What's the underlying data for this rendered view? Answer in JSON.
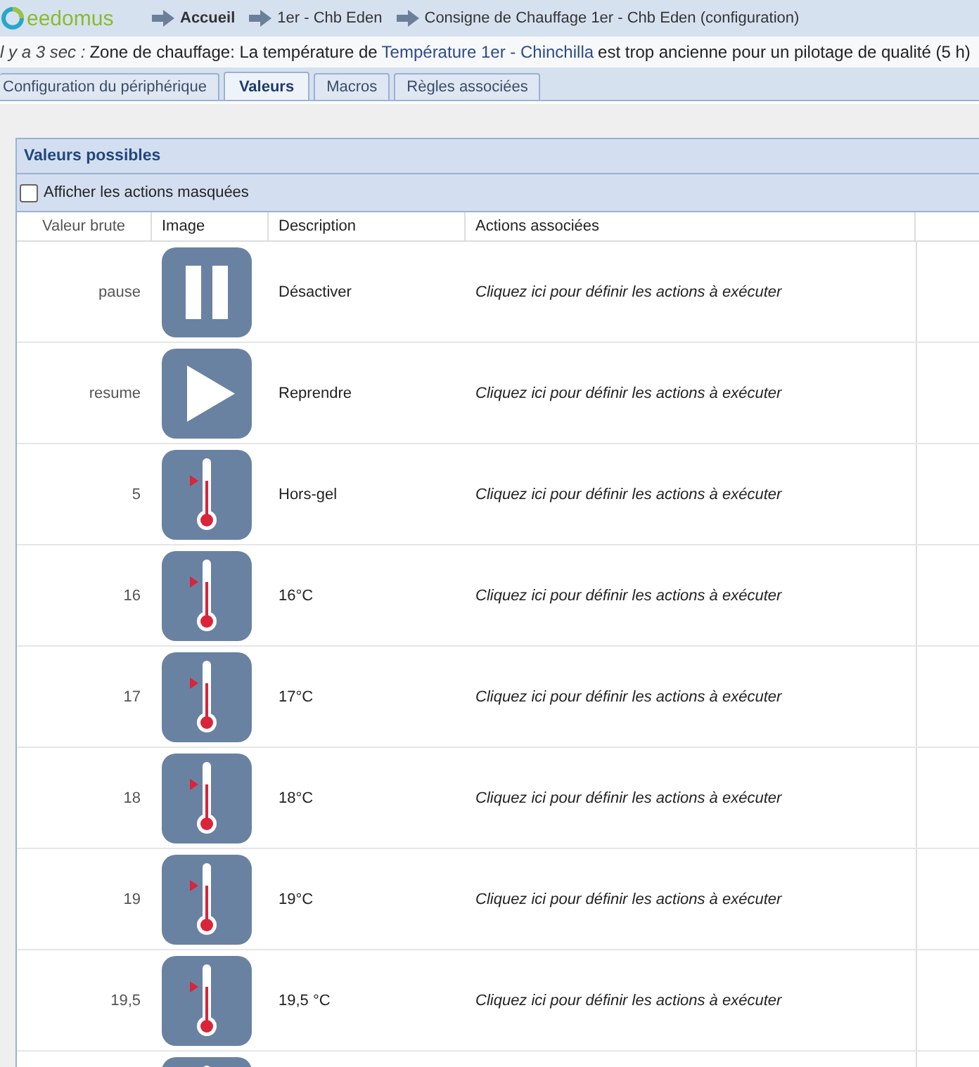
{
  "header": {
    "logo": "eedomus",
    "breadcrumbs": [
      {
        "label": "Accueil",
        "current": true
      },
      {
        "label": "1er - Chb Eden",
        "current": false
      },
      {
        "label": "Consigne de Chauffage 1er - Chb Eden (configuration)",
        "current": false
      }
    ]
  },
  "notice": {
    "time": "l y a 3 sec :",
    "before": "Zone de chauffage: La température de",
    "link": "Température 1er - Chinchilla",
    "after": "est trop ancienne pour un pilotage de qualité (5 h)"
  },
  "tabs": [
    {
      "label": "Configuration du périphérique",
      "selected": false
    },
    {
      "label": "Valeurs",
      "selected": true
    },
    {
      "label": "Macros",
      "selected": false
    },
    {
      "label": "Règles associées",
      "selected": false
    }
  ],
  "panel": {
    "title": "Valeurs possibles",
    "show_hidden": {
      "label": "Afficher les actions masquées",
      "checked": false
    },
    "table": {
      "columns": [
        "Valeur brute",
        "Image",
        "Description",
        "Actions associées"
      ],
      "rows": [
        {
          "value": "pause",
          "kind": "pause",
          "description": "Désactiver",
          "actions": "Cliquez ici pour définir les actions à exécuter"
        },
        {
          "value": "resume",
          "kind": "play",
          "description": "Reprendre",
          "actions": "Cliquez ici pour définir les actions à exécuter"
        },
        {
          "value": "5",
          "kind": "thermometer",
          "description": "Hors-gel",
          "actions": "Cliquez ici pour définir les actions à exécuter"
        },
        {
          "value": "16",
          "kind": "thermometer",
          "description": "16°C",
          "actions": "Cliquez ici pour définir les actions à exécuter"
        },
        {
          "value": "17",
          "kind": "thermometer",
          "description": "17°C",
          "actions": "Cliquez ici pour définir les actions à exécuter"
        },
        {
          "value": "18",
          "kind": "thermometer",
          "description": "18°C",
          "actions": "Cliquez ici pour définir les actions à exécuter"
        },
        {
          "value": "19",
          "kind": "thermometer",
          "description": "19°C",
          "actions": "Cliquez ici pour définir les actions à exécuter"
        },
        {
          "value": "19,5",
          "kind": "thermometer",
          "description": "19,5 °C",
          "actions": "Cliquez ici pour définir les actions à exécuter"
        }
      ],
      "partial_row": {
        "kind": "thermometer"
      }
    }
  }
}
